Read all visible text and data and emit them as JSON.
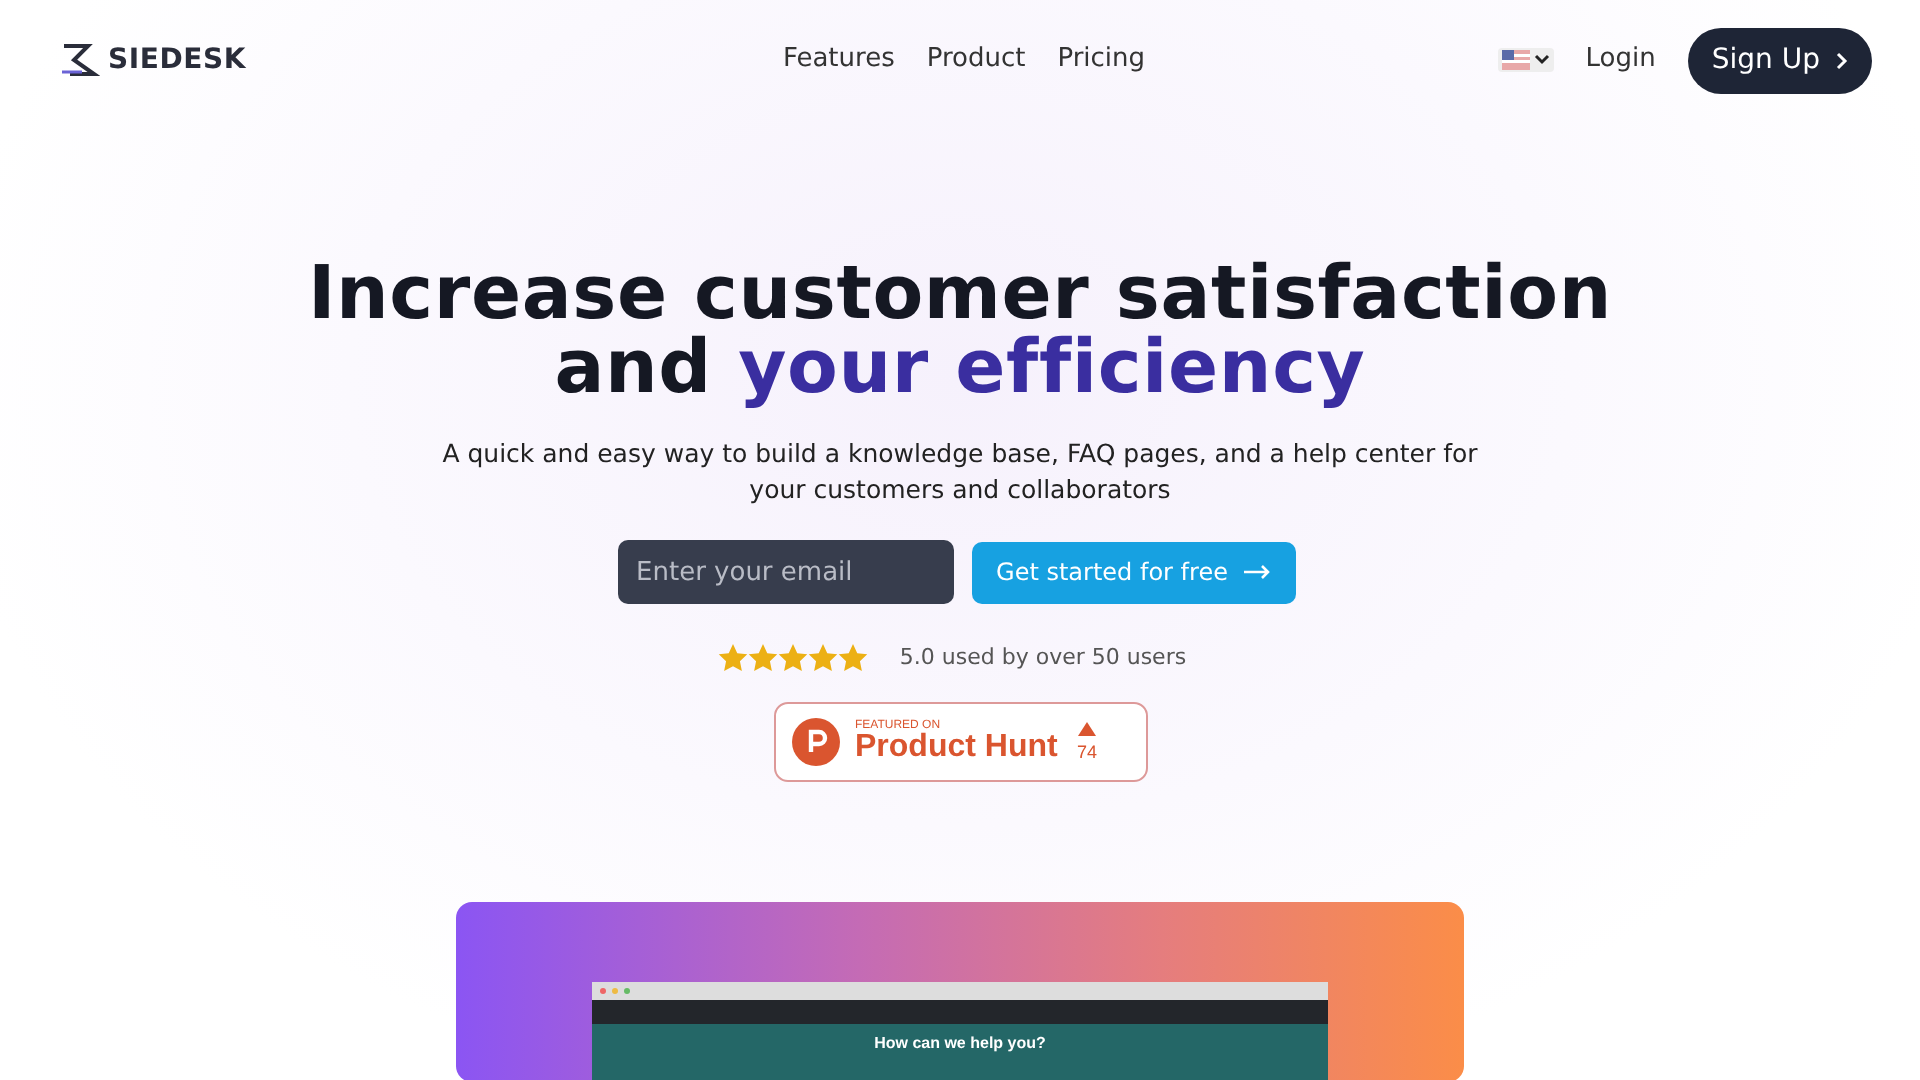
{
  "navbar": {
    "logo": "SIEDESK",
    "links": [
      "Features",
      "Product",
      "Pricing"
    ],
    "login": "Login",
    "signup": "Sign Up"
  },
  "hero": {
    "headline_line_1": "Increase customer satisfaction",
    "headline_line_2": "and",
    "headline_highlight": "your efficiency",
    "subtitle": "A quick and easy way to build a knowledge base, FAQ pages, and a help center for your customers and collaborators",
    "email": {
      "placeholder": "Enter your email"
    },
    "cta": "Get started for free",
    "rating": {
      "stars": 5,
      "text": "5.0 used by over 50 users"
    },
    "product_hunt": {
      "featured": "FEATURED ON",
      "name": "Product Hunt",
      "votes": "74"
    }
  },
  "preview": {
    "heading": "How can we help you?"
  }
}
